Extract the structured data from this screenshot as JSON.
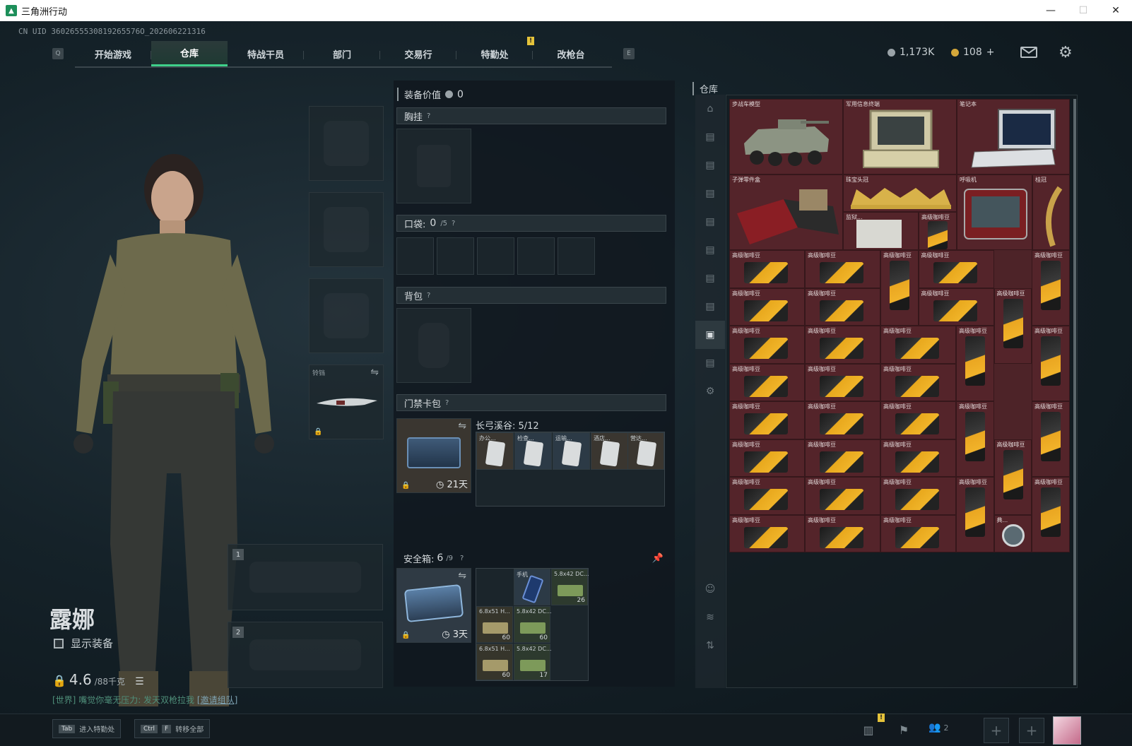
{
  "window": {
    "title": "三角洲行动",
    "minimize": "—",
    "maximize": "☐",
    "close": "✕"
  },
  "uid": "CN UID 3602655530819265576O_202606221316",
  "nav": {
    "key_left": "Q",
    "key_right": "E",
    "tabs": [
      "开始游戏",
      "仓库",
      "特战干员",
      "部门",
      "交易行",
      "特勤处",
      "改枪台"
    ],
    "active": "仓库",
    "alert": "!"
  },
  "currency": {
    "silver": "1,173K",
    "gold": "108",
    "gold_plus": "+"
  },
  "character": {
    "name": "露娜",
    "show_equipment": "显示装备",
    "weight": "4.6",
    "weight_max": "/88千克"
  },
  "chat": {
    "channel": "[世界]",
    "message": "嘴觉你毫无压力: 发天双枪拉我",
    "invite": "[邀请组队]"
  },
  "slots": {
    "melee_label": "铃铛",
    "weapon1": "1",
    "weapon2": "2"
  },
  "gear": {
    "value_label": "装备价值",
    "value": "0",
    "chest": "胸挂",
    "pocket": "口袋:",
    "pocket_count": "0",
    "pocket_max": "/5",
    "backpack": "背包",
    "keycard": "门禁卡包",
    "keycard_map": "长弓溪谷: 5/12",
    "keycard_days": "21天",
    "keycards": [
      "办公...",
      "检查...",
      "运输...",
      "酒店...",
      "营达..."
    ],
    "safe": "安全箱:",
    "safe_count": "6",
    "safe_max": "/9",
    "safe_days": "3天",
    "safe_items": [
      {
        "name": "手机",
        "count": ""
      },
      {
        "name": "5.8x42 DC...",
        "count": "26"
      },
      {
        "name": "6.8x51 H...",
        "count": "60"
      },
      {
        "name": "5.8x42 DC...",
        "count": "60"
      },
      {
        "name": "6.8x51 H...",
        "count": "60"
      },
      {
        "name": "5.8x42 DC...",
        "count": "17"
      }
    ],
    "help": "?"
  },
  "warehouse": {
    "title": "仓库",
    "items_top": [
      "步战车模型",
      "军用信息终端",
      "笔记本",
      "子弹零件盒",
      "珠宝头冠",
      "呼吸机",
      "桂冠",
      "监狱...",
      "高级咖啡豆"
    ],
    "coffee": "高级咖啡豆",
    "extra": "典..."
  },
  "bottom": {
    "tab_key": "Tab",
    "tab_label": "进入特勤处",
    "ctrl_key": "Ctrl",
    "f_key": "F",
    "transfer_label": "转移全部",
    "friends": "2",
    "alert": "!",
    "plus": "+"
  },
  "colors": {
    "accent": "#3fd08a",
    "warehouse_bg": "#4d2328",
    "coffee_gold": "#f0b429"
  }
}
